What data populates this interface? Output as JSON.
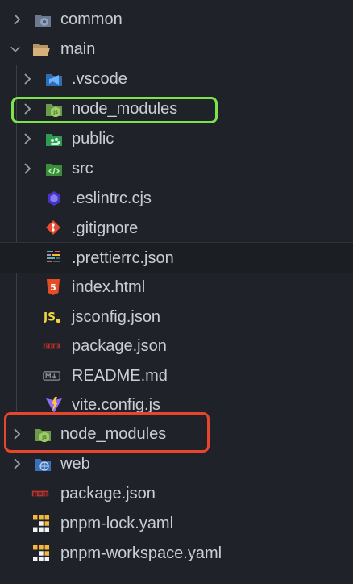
{
  "tree": [
    {
      "label": "common",
      "type": "folder",
      "icon": "folder-gear-icon",
      "expanded": false
    },
    {
      "label": "main",
      "type": "folder",
      "icon": "folder-open-icon",
      "expanded": true
    },
    {
      "label": ".vscode",
      "type": "folder",
      "icon": "vscode-folder-icon",
      "expanded": false
    },
    {
      "label": "node_modules",
      "type": "folder",
      "icon": "node-folder-icon",
      "expanded": false
    },
    {
      "label": "public",
      "type": "folder",
      "icon": "public-folder-icon",
      "expanded": false
    },
    {
      "label": "src",
      "type": "folder",
      "icon": "src-folder-icon",
      "expanded": false
    },
    {
      "label": ".eslintrc.cjs",
      "type": "file",
      "icon": "eslint-icon"
    },
    {
      "label": ".gitignore",
      "type": "file",
      "icon": "git-icon"
    },
    {
      "label": ".prettierrc.json",
      "type": "file",
      "icon": "prettier-icon"
    },
    {
      "label": "index.html",
      "type": "file",
      "icon": "html5-icon"
    },
    {
      "label": "jsconfig.json",
      "type": "file",
      "icon": "js-icon"
    },
    {
      "label": "package.json",
      "type": "file",
      "icon": "npm-icon"
    },
    {
      "label": "README.md",
      "type": "file",
      "icon": "markdown-icon"
    },
    {
      "label": "vite.config.js",
      "type": "file",
      "icon": "vite-icon"
    },
    {
      "label": "node_modules",
      "type": "folder",
      "icon": "node-folder-icon",
      "expanded": false
    },
    {
      "label": "web",
      "type": "folder",
      "icon": "folder-web-icon",
      "expanded": false
    },
    {
      "label": "package.json",
      "type": "file",
      "icon": "npm-icon"
    },
    {
      "label": "pnpm-lock.yaml",
      "type": "file",
      "icon": "pnpm-icon"
    },
    {
      "label": "pnpm-workspace.yaml",
      "type": "file",
      "icon": "pnpm-icon"
    }
  ],
  "highlights": {
    "green": "#7ee34b",
    "red": "#e8462c"
  }
}
